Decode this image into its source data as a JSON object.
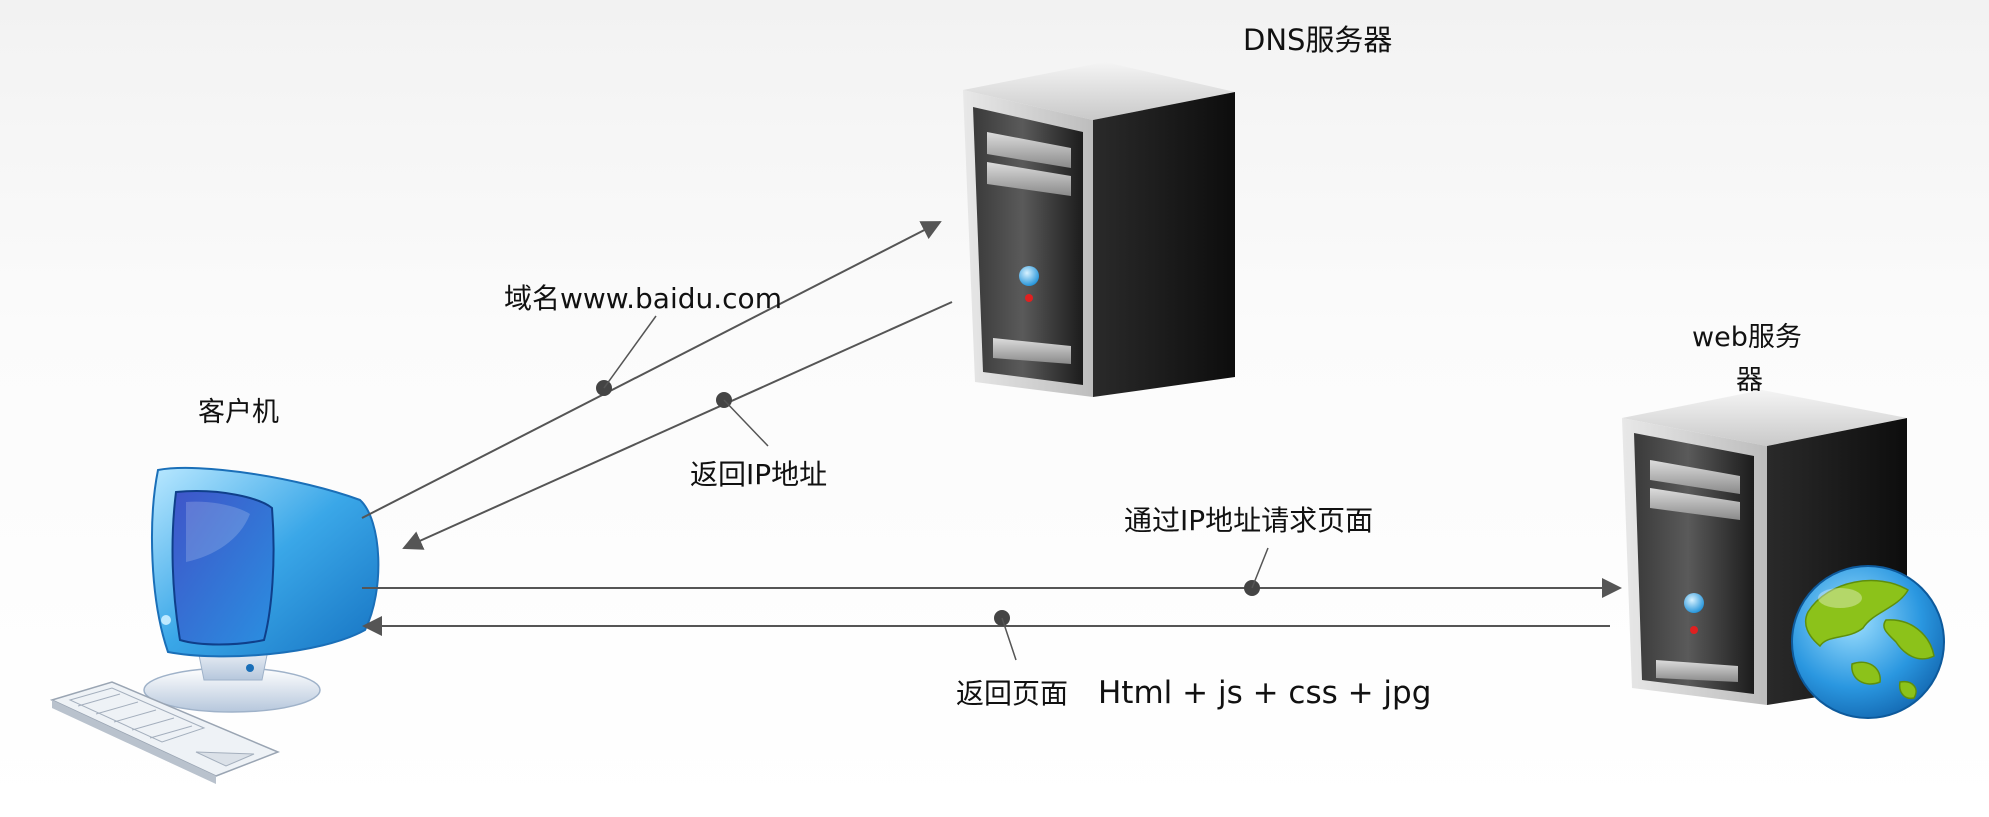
{
  "nodes": {
    "dns_server": {
      "label": "DNS服务器",
      "icon": "server-icon"
    },
    "web_server": {
      "label_line1": "web服务",
      "label_line2": "器",
      "icon": "server-with-globe-icon"
    },
    "client": {
      "label": "客户机",
      "icon": "desktop-computer-icon"
    }
  },
  "edges": {
    "domain_request": {
      "label": "域名www.baidu.com",
      "from": "client",
      "to": "dns_server"
    },
    "ip_return": {
      "label": "返回IP地址",
      "from": "dns_server",
      "to": "client"
    },
    "page_request": {
      "label": "通过IP地址请求页面",
      "from": "client",
      "to": "web_server"
    },
    "page_return": {
      "label_cn": "返回页面",
      "label_en": "Html + js + css + jpg",
      "from": "web_server",
      "to": "client"
    }
  },
  "colors": {
    "line": "#555555",
    "dot": "#444444",
    "monitor_blue": "#3aa7e8",
    "globe_blue": "#1f86d6",
    "globe_green": "#8cc21a"
  }
}
